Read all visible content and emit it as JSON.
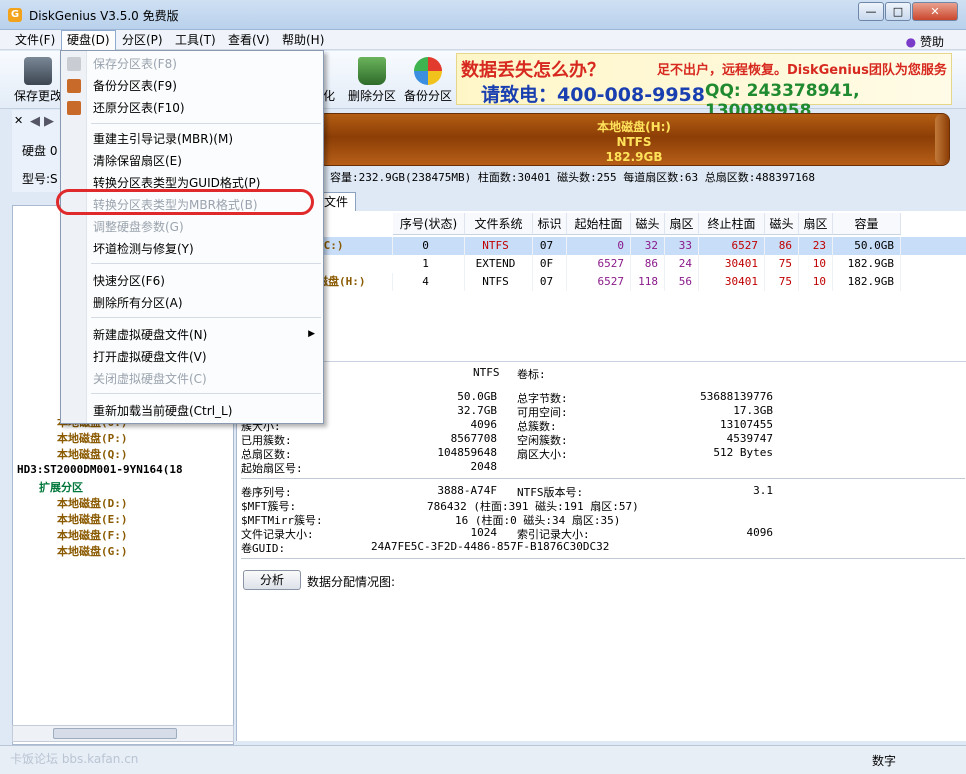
{
  "window": {
    "title": "DiskGenius V3.5.0 免费版",
    "minimize": "0",
    "maximize": "1",
    "close": "r"
  },
  "menubar": {
    "items": [
      "文件(F)",
      "硬盘(D)",
      "分区(P)",
      "工具(T)",
      "查看(V)",
      "帮助(H)"
    ],
    "sponsor": "赞助"
  },
  "toolbar": {
    "save_label": "保存更改",
    "format_suffix": "化",
    "delete_label": "删除分区",
    "backup_label": "备份分区"
  },
  "banner": {
    "line1": "数据丢失怎么办？",
    "line1b": "足不出户，远程恢复。DiskGenius团队为您服务",
    "line2": "请致电：400-008-9958",
    "line2b": "QQ: 243378941, 130089958"
  },
  "left_panel": {
    "disk_label": "硬盘 0",
    "model_label": "型号:S"
  },
  "disk_bar": {
    "name": "本地磁盘(H:)",
    "fs": "NTFS",
    "size": "182.9GB"
  },
  "info_line": "容量:232.9GB(238475MB)   柱面数:30401   磁头数:255   每道扇区数:63   总扇区数:488397168",
  "tab": {
    "label": "文件"
  },
  "partition_table": {
    "headers": [
      "序号(状态)",
      "文件系统",
      "标识",
      "起始柱面",
      "磁头",
      "扇区",
      "终止柱面",
      "磁头",
      "扇区",
      "容量"
    ],
    "rows": [
      {
        "name": "(C:)",
        "index": "0",
        "fs": "NTFS",
        "id": "07",
        "start_cyl": "0",
        "start_head": "32",
        "start_sec": "33",
        "end_cyl": "6527",
        "end_head": "86",
        "end_sec": "23",
        "cap": "50.0GB"
      },
      {
        "name": "",
        "index": "1",
        "fs": "EXTEND",
        "id": "0F",
        "start_cyl": "6527",
        "start_head": "86",
        "start_sec": "24",
        "end_cyl": "30401",
        "end_head": "75",
        "end_sec": "10",
        "cap": "182.9GB"
      },
      {
        "name": "磁盘(H:)",
        "index": "4",
        "fs": "NTFS",
        "id": "07",
        "start_cyl": "6527",
        "start_head": "118",
        "start_sec": "56",
        "end_cyl": "30401",
        "end_head": "75",
        "end_sec": "10",
        "cap": "182.9GB"
      }
    ]
  },
  "details": {
    "fs": "NTFS",
    "vol_label": "卷标:",
    "total_size": "50.0GB",
    "total_bytes_label": "总字节数:",
    "total_bytes": "53688139776",
    "used_size": "32.7GB",
    "free_label": "可用空间:",
    "free": "17.3GB",
    "cluster_label": "簇大小:",
    "cluster": "4096",
    "total_clusters_label": "总簇数:",
    "total_clusters": "13107455",
    "used_clusters_label": "已用簇数:",
    "used_clusters": "8567708",
    "free_clusters_label": "空闲簇数:",
    "free_clusters": "4539747",
    "total_sectors_label": "总扇区数:",
    "total_sectors": "104859648",
    "sector_size_label": "扇区大小:",
    "sector_size": "512 Bytes",
    "start_sector_label": "起始扇区号:",
    "start_sector": "2048",
    "serial_label": "卷序列号:",
    "serial": "3888-A74F",
    "ntfs_ver_label": "NTFS版本号:",
    "ntfs_ver": "3.1",
    "mft_label": "$MFT簇号:",
    "mft": "786432 (柱面:391 磁头:191 扇区:57)",
    "mftmirr_label": "$MFTMirr簇号:",
    "mftmirr": "16 (柱面:0 磁头:34 扇区:35)",
    "frs_label": "文件记录大小:",
    "frs": "1024",
    "index_label": "索引记录大小:",
    "index": "4096",
    "guid_label": "卷GUID:",
    "guid": "24A7FE5C-3F2D-4486-857F-B1876C30DC32",
    "analyze_button": "分析",
    "distribution_label": "数据分配情况图:"
  },
  "tree": {
    "disk3": "HD3:ST2000DM001-9YN164(18",
    "ext": "扩展分区",
    "items_upper": [
      "本地磁盘(O:)",
      "本地磁盘(P:)",
      "本地磁盘(Q:)"
    ],
    "items_lower": [
      "本地磁盘(D:)",
      "本地磁盘(E:)",
      "本地磁盘(F:)",
      "本地磁盘(G:)"
    ]
  },
  "hard_disk_menu": {
    "items": [
      {
        "label": "保存分区表(F8)",
        "disabled": true
      },
      {
        "label": "备份分区表(F9)",
        "disabled": false
      },
      {
        "label": "还原分区表(F10)",
        "disabled": false
      },
      {
        "label": "重建主引导记录(MBR)(M)",
        "disabled": false
      },
      {
        "label": "清除保留扇区(E)",
        "disabled": false
      },
      {
        "label": "转换分区表类型为GUID格式(P)",
        "disabled": false
      },
      {
        "label": "转换分区表类型为MBR格式(B)",
        "disabled": true
      },
      {
        "label": "调整硬盘参数(G)",
        "disabled": true
      },
      {
        "label": "坏道检测与修复(Y)",
        "disabled": false
      },
      {
        "label": "快速分区(F6)",
        "disabled": false
      },
      {
        "label": "删除所有分区(A)",
        "disabled": false
      },
      {
        "label": "新建虚拟硬盘文件(N)",
        "disabled": false
      },
      {
        "label": "打开虚拟硬盘文件(V)",
        "disabled": false
      },
      {
        "label": "关闭虚拟硬盘文件(C)",
        "disabled": true
      },
      {
        "label": "重新加载当前硬盘(Ctrl_L)",
        "disabled": false
      }
    ]
  },
  "statusbar": {
    "watermark": "卡饭论坛 bbs.kafan.cn",
    "num": "数字"
  }
}
